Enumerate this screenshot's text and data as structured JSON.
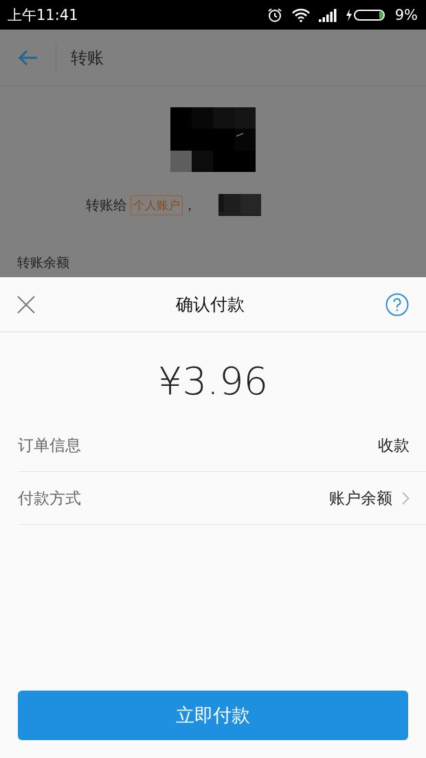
{
  "status_bar": {
    "time": "上午11:41",
    "battery": "9%"
  },
  "page": {
    "title": "转账",
    "recipient_prefix": "转账给",
    "account_tag": "个人账户",
    "separator": "，",
    "amount_label": "转账余额"
  },
  "sheet": {
    "title": "确认付款",
    "amount": "¥3.96",
    "rows": [
      {
        "label": "订单信息",
        "value": "收款",
        "kind": "plain"
      },
      {
        "label": "付款方式",
        "value": "账户余额",
        "kind": "link"
      }
    ],
    "button": "立即付款"
  }
}
